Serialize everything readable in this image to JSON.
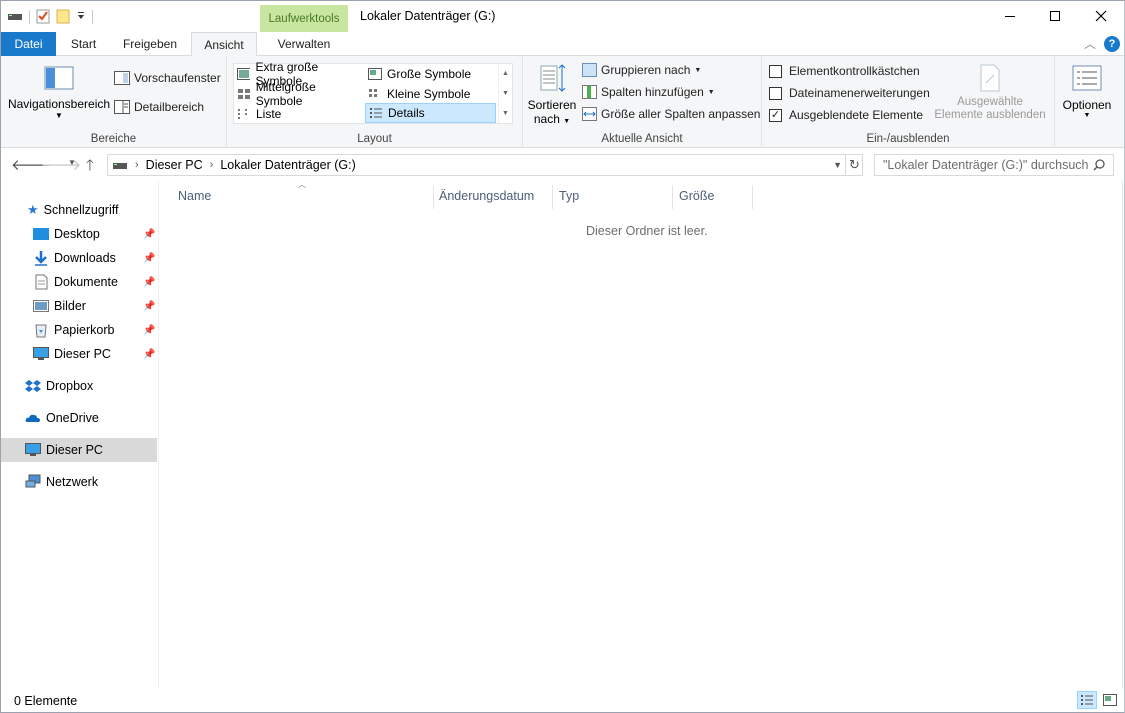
{
  "window": {
    "title": "Lokaler Datenträger (G:)",
    "context_tab": "Laufwerktools"
  },
  "tabs": {
    "file": "Datei",
    "start": "Start",
    "share": "Freigeben",
    "view": "Ansicht",
    "manage": "Verwalten"
  },
  "ribbon": {
    "bereiche": {
      "label": "Bereiche",
      "nav_pane": "Navigationsbereich",
      "preview": "Vorschaufenster",
      "details": "Detailbereich"
    },
    "layout": {
      "label": "Layout",
      "items": [
        "Extra große Symbole",
        "Große Symbole",
        "Mittelgroße Symbole",
        "Kleine Symbole",
        "Liste",
        "Details"
      ],
      "selected": "Details"
    },
    "current_view": {
      "label": "Aktuelle Ansicht",
      "sort": "Sortieren",
      "sort2": "nach",
      "group_by": "Gruppieren nach",
      "add_columns": "Spalten hinzufügen",
      "fit_columns": "Größe aller Spalten anpassen"
    },
    "show_hide": {
      "label": "Ein-/ausblenden",
      "item_checkboxes": "Elementkontrollkästchen",
      "item_checkboxes_checked": false,
      "file_extensions": "Dateinamenerweiterungen",
      "file_extensions_checked": false,
      "hidden_items": "Ausgeblendete Elemente",
      "hidden_items_checked": true,
      "hide_selected_1": "Ausgewählte",
      "hide_selected_2": "Elemente ausblenden"
    },
    "options": "Optionen"
  },
  "address": {
    "crumbs": [
      "Dieser PC",
      "Lokaler Datenträger (G:)"
    ],
    "search_placeholder": "\"Lokaler Datenträger (G:)\" durchsuch"
  },
  "nav_pane": {
    "quick_access": "Schnellzugriff",
    "pinned": [
      "Desktop",
      "Downloads",
      "Dokumente",
      "Bilder",
      "Papierkorb",
      "Dieser PC"
    ],
    "dropbox": "Dropbox",
    "onedrive": "OneDrive",
    "this_pc": "Dieser PC",
    "network": "Netzwerk"
  },
  "columns": [
    "Name",
    "Änderungsdatum",
    "Typ",
    "Größe"
  ],
  "empty_message": "Dieser Ordner ist leer.",
  "status": {
    "count": "0 Elemente"
  },
  "colors": {
    "file_tab": "#1979ca",
    "context_tab_bg": "#c8e6a0",
    "selection": "#cce8ff",
    "nav_selected": "#d9d9d9"
  }
}
